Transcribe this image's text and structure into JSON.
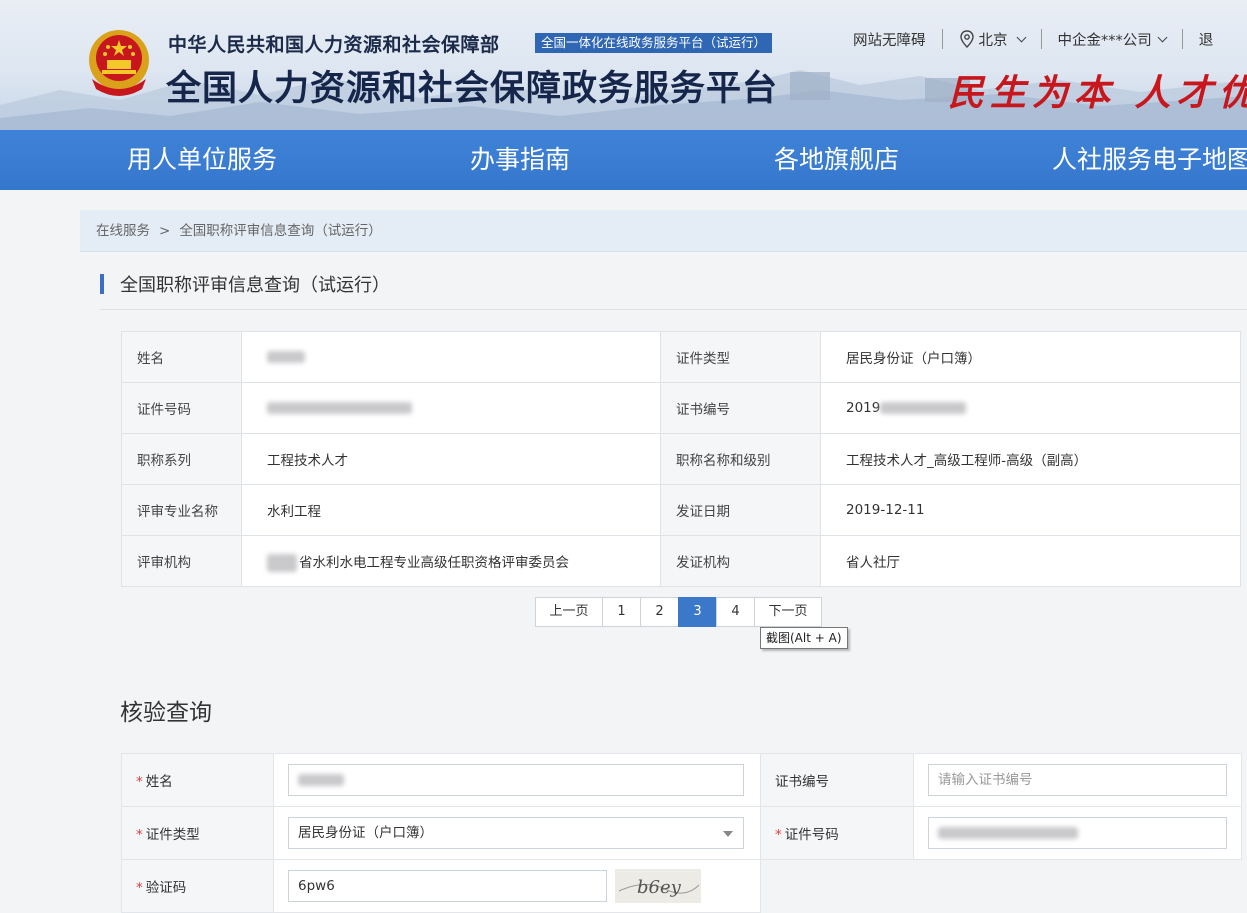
{
  "header": {
    "ministry": "中华人民共和国人力资源和社会保障部",
    "platform_tag": "全国一体化在线政务服务平台（试运行）",
    "site_title": "全国人力资源和社会保障政务服务平台",
    "slogan": "民生为本 人才优",
    "accessibility": "网站无障碍",
    "location": "北京",
    "company": "中企金***公司",
    "logout": "退"
  },
  "nav": {
    "items": [
      "用人单位服务",
      "办事指南",
      "各地旗舰店",
      "人社服务电子地图"
    ]
  },
  "breadcrumb": {
    "home": "在线服务",
    "separator": ">",
    "current": "全国职称评审信息查询（试运行）"
  },
  "section": {
    "title": "全国职称评审信息查询（试运行）"
  },
  "record": {
    "name_label": "姓名",
    "id_type_label": "证件类型",
    "id_type": "居民身份证（户口簿）",
    "id_no_label": "证件号码",
    "cert_no_label": "证书编号",
    "cert_no_prefix": "2019",
    "series_label": "职称系列",
    "series": "工程技术人才",
    "title_level_label": "职称名称和级别",
    "title_level": "工程技术人才_高级工程师-高级（副高）",
    "major_label": "评审专业名称",
    "major": "水利工程",
    "issue_date_label": "发证日期",
    "issue_date": "2019-12-11",
    "org_label": "评审机构",
    "org": "省水利水电工程专业高级任职资格评审委员会",
    "issuer_label": "发证机构",
    "issuer": "省人社厅"
  },
  "pagination": {
    "prev": "上一页",
    "pages": [
      "1",
      "2",
      "3",
      "4"
    ],
    "current": "3",
    "next": "下一页",
    "tooltip": "截图(Alt + A)"
  },
  "verify": {
    "title": "核验查询",
    "required_mark": "*",
    "name_label": "姓名",
    "cert_no_label": "证书编号",
    "cert_no_placeholder": "请输入证书编号",
    "id_type_label": "证件类型",
    "id_type_value": "居民身份证（户口簿）",
    "id_no_label": "证件号码",
    "captcha_label": "验证码",
    "captcha_value": "6pw6",
    "captcha_image_text": "b6ey"
  }
}
